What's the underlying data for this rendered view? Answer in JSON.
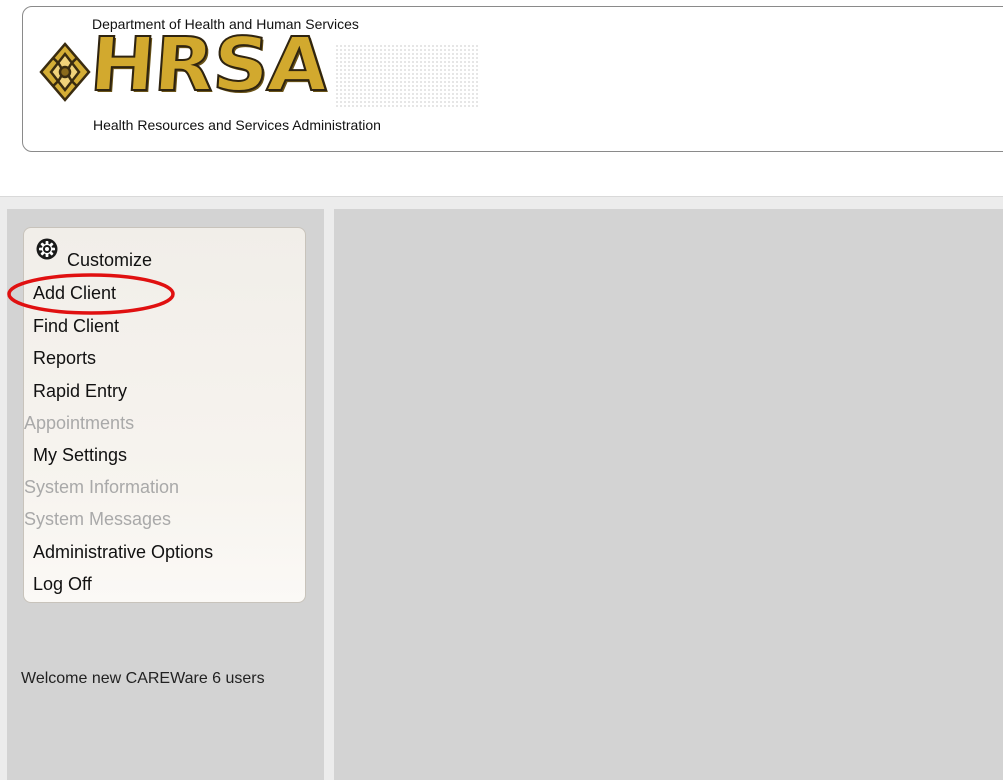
{
  "header": {
    "department": "Department of Health and Human Services",
    "logo_letters": "HRSA",
    "administration": "Health Resources and Services Administration"
  },
  "menu": {
    "customize": "Customize",
    "items": [
      {
        "label": "Add Client",
        "enabled": true
      },
      {
        "label": "Find Client",
        "enabled": true
      },
      {
        "label": "Reports",
        "enabled": true
      },
      {
        "label": "Rapid Entry",
        "enabled": true
      },
      {
        "label": "Appointments",
        "enabled": false
      },
      {
        "label": "My Settings",
        "enabled": true
      },
      {
        "label": "System Information",
        "enabled": false
      },
      {
        "label": "System Messages",
        "enabled": false
      },
      {
        "label": "Administrative Options",
        "enabled": true
      },
      {
        "label": "Log Off",
        "enabled": true
      }
    ]
  },
  "welcome": "Welcome new CAREWare 6 users",
  "colors": {
    "highlight": "#e01010",
    "panel": "#d3d3d3",
    "disabled_text": "#a9a9a9"
  },
  "icons": {
    "customize": "gear-icon",
    "logo_mark": "hrsa-emblem-icon"
  }
}
